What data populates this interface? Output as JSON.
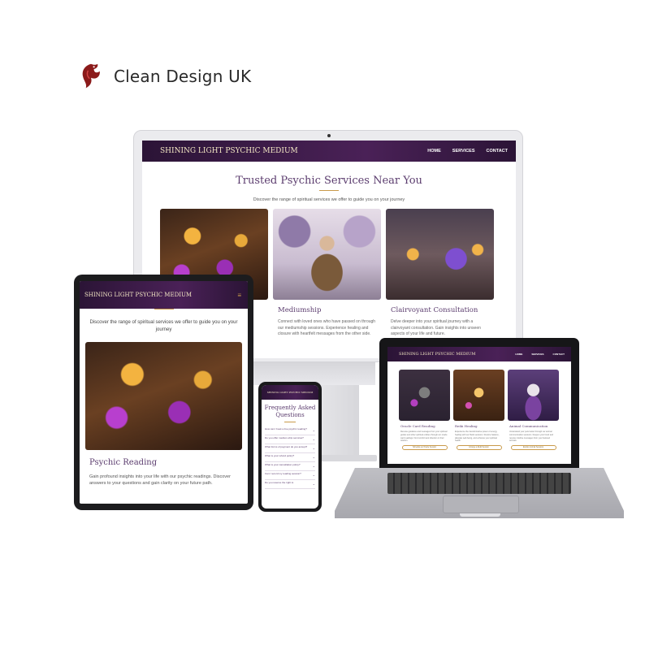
{
  "brand": {
    "name": "Clean Design UK",
    "logo_icon": "dragon-icon",
    "logo_color": "#8b1a1a"
  },
  "site": {
    "title": "SHINING LIGHT PSYCHIC MEDIUM",
    "nav": [
      "HOME",
      "SERVICES",
      "CONTACT"
    ],
    "accent": "#c99a4a",
    "nav_bg": "#3a1b48"
  },
  "desktop": {
    "heading": "Trusted Psychic Services Near You",
    "subheading": "Discover the range of spiritual services we offer to guide you on your journey",
    "cards": [
      {
        "title": "",
        "text": ""
      },
      {
        "title": "Mediumship",
        "text": "Connect with loved ones who have passed on through our mediumship sessions. Experience healing and closure with heartfelt messages from the other side."
      },
      {
        "title": "Clairvoyant Consultation",
        "text": "Delve deeper into your spiritual journey with a clairvoyant consultation. Gain insights into unseen aspects of your life and future."
      }
    ]
  },
  "tablet": {
    "menu_icon": "≡",
    "subheading": "Discover the range of spiritual services we offer to guide you on your journey",
    "card_title": "Psychic Reading",
    "card_text": "Gain profound insights into your life with our psychic readings. Discover answers to your questions and gain clarity on your future path."
  },
  "phone": {
    "heading": "Frequently Asked Questions",
    "faq": [
      "How can I book a live psychic reading?",
      "Do you offer medium-ship services?",
      "What forms of payment do you accept?",
      "What is your refund policy?",
      "What is your cancellation policy?",
      "Can I record my reading session?",
      "Do you reserve the right to"
    ]
  },
  "laptop": {
    "cards": [
      {
        "title": "Oracle Card Reading",
        "text": "Receive guidance and messages from your spiritual guides and other spiritual entities through our oracle card readings. Find comfort and direction in their wisdom.",
        "button": "Schedule an Oracle Session"
      },
      {
        "title": "Reiki Healing",
        "text": "Experience the transformative power of energy healing with our Reiki sessions. Restore balance, alleviate well-being, and enhance your spiritual health.",
        "button": "Arrange a Reiki Session"
      },
      {
        "title": "Animal Communication",
        "text": "Understand your pets better through our animal communication sessions. Deepen your bond and receive intuitive messages from your beloved animals.",
        "button": "Explore Animal Sessions"
      }
    ]
  }
}
